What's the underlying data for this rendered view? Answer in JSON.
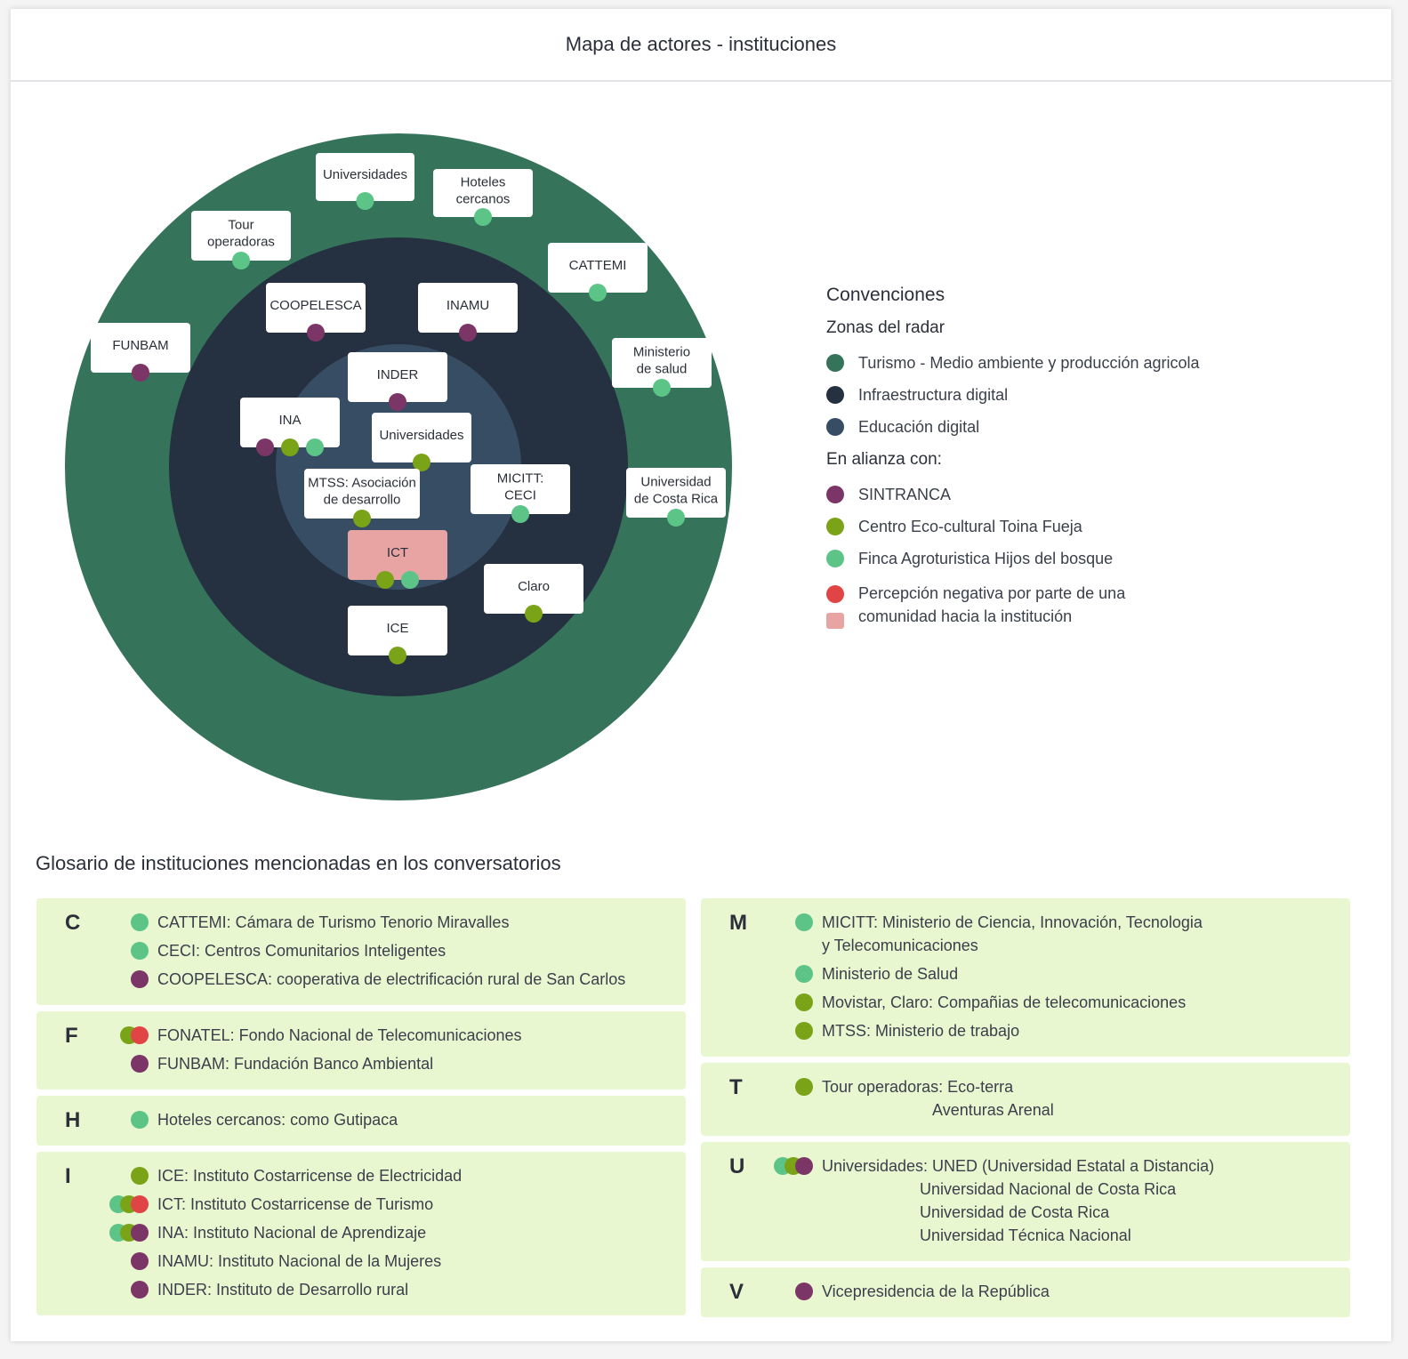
{
  "title": "Mapa de actores - instituciones",
  "colors": {
    "zone_outer": "#35735a",
    "zone_middle": "#253040",
    "zone_inner": "#374d63",
    "sintranca": "#7c3567",
    "toina": "#7aa317",
    "finca": "#5cc487",
    "negative": "#e04444",
    "negative_fill": "#e8a3a3"
  },
  "radar": {
    "nodes": [
      {
        "lines": [
          "Universidades"
        ],
        "dots": [
          "finca"
        ]
      },
      {
        "lines": [
          "Hoteles",
          "cercanos"
        ],
        "dots": [
          "finca"
        ]
      },
      {
        "lines": [
          "Tour",
          "operadoras"
        ],
        "dots": [
          "finca"
        ]
      },
      {
        "lines": [
          "CATTEMI"
        ],
        "dots": [
          "finca"
        ]
      },
      {
        "lines": [
          "FUNBAM"
        ],
        "dots": [
          "sintranca"
        ]
      },
      {
        "lines": [
          "Ministerio",
          "de salud"
        ],
        "dots": [
          "finca"
        ]
      },
      {
        "lines": [
          "Universidad",
          "de Costa Rica"
        ],
        "dots": [
          "finca"
        ]
      },
      {
        "lines": [
          "COOPELESCA"
        ],
        "dots": [
          "sintranca"
        ]
      },
      {
        "lines": [
          "INAMU"
        ],
        "dots": [
          "sintranca"
        ]
      },
      {
        "lines": [
          "INDER"
        ],
        "dots": [
          "sintranca"
        ]
      },
      {
        "lines": [
          "INA"
        ],
        "dots": [
          "sintranca",
          "toina",
          "finca"
        ]
      },
      {
        "lines": [
          "Universidades"
        ],
        "dots": [
          "toina"
        ]
      },
      {
        "lines": [
          "MTSS: Asociación",
          "de desarrollo"
        ],
        "dots": [
          "toina"
        ]
      },
      {
        "lines": [
          "MICITT:",
          "CECI"
        ],
        "dots": [
          "finca"
        ]
      },
      {
        "lines": [
          "ICT"
        ],
        "dots": [
          "toina",
          "finca"
        ],
        "negative": true
      },
      {
        "lines": [
          "Claro"
        ],
        "dots": [
          "toina"
        ]
      },
      {
        "lines": [
          "ICE"
        ],
        "dots": [
          "toina"
        ]
      }
    ]
  },
  "legend": {
    "heading": "Convenciones",
    "zones_title": "Zonas del radar",
    "zones": [
      {
        "label": "Turismo - Medio ambiente y producción agricola",
        "color": "zone_outer"
      },
      {
        "label": "Infraestructura digital",
        "color": "zone_middle"
      },
      {
        "label": "Educación digital",
        "color": "zone_inner"
      }
    ],
    "alliance_title": "En alianza con:",
    "alliances": [
      {
        "label": "SINTRANCA",
        "color": "sintranca"
      },
      {
        "label": "Centro Eco-cultural Toina Fueja",
        "color": "toina"
      },
      {
        "label": "Finca Agroturistica Hijos del bosque",
        "color": "finca"
      }
    ],
    "negative_label": "Percepción negativa por parte de una\ncomunidad hacia la institución"
  },
  "glossary": {
    "title": "Glosario de instituciones mencionadas en los conversatorios",
    "left": [
      {
        "letter": "C",
        "items": [
          {
            "text": "CATTEMI: Cámara de Turismo Tenorio Miravalles",
            "dots": [
              "finca"
            ]
          },
          {
            "text": "CECI: Centros Comunitarios Inteligentes",
            "dots": [
              "finca"
            ]
          },
          {
            "text": "COOPELESCA: cooperativa de electrificación rural de San Carlos",
            "dots": [
              "sintranca"
            ]
          }
        ]
      },
      {
        "letter": "F",
        "items": [
          {
            "text": "FONATEL: Fondo Nacional de Telecomunicaciones",
            "dots": [
              "toina",
              "negative"
            ]
          },
          {
            "text": "FUNBAM: Fundación Banco Ambiental",
            "dots": [
              "sintranca"
            ]
          }
        ]
      },
      {
        "letter": "H",
        "items": [
          {
            "text": "Hoteles cercanos: como Gutipaca",
            "dots": [
              "finca"
            ]
          }
        ]
      },
      {
        "letter": "I",
        "items": [
          {
            "text": "ICE: Instituto Costarricense de Electricidad",
            "dots": [
              "toina"
            ]
          },
          {
            "text": "ICT: Instituto Costarricense de Turismo",
            "dots": [
              "finca",
              "toina",
              "negative"
            ]
          },
          {
            "text": "INA: Instituto Nacional de Aprendizaje",
            "dots": [
              "finca",
              "toina",
              "sintranca"
            ]
          },
          {
            "text": "INAMU: Instituto Nacional de la Mujeres",
            "dots": [
              "sintranca"
            ]
          },
          {
            "text": "INDER: Instituto de Desarrollo rural",
            "dots": [
              "sintranca"
            ]
          }
        ]
      }
    ],
    "right": [
      {
        "letter": "M",
        "items": [
          {
            "text": "MICITT: Ministerio de Ciencia, Innovación, Tecnologia\ny Telecomunicaciones",
            "dots": [
              "finca"
            ]
          },
          {
            "text": "Ministerio de Salud",
            "dots": [
              "finca"
            ]
          },
          {
            "text": "Movistar, Claro: Compañias de telecomunicaciones",
            "dots": [
              "toina"
            ]
          },
          {
            "text": "MTSS: Ministerio de trabajo",
            "dots": [
              "toina"
            ]
          }
        ]
      },
      {
        "letter": "T",
        "items": [
          {
            "text": "Tour operadoras: Eco-terra\n                         Aventuras Arenal",
            "dots": [
              "toina"
            ]
          }
        ]
      },
      {
        "letter": "U",
        "items": [
          {
            "text": "Universidades: UNED (Universidad Estatal a Distancia)\n                      Universidad Nacional de Costa Rica\n                      Universidad de Costa Rica\n                      Universidad Técnica Nacional",
            "dots": [
              "finca",
              "toina",
              "sintranca"
            ]
          }
        ]
      },
      {
        "letter": "V",
        "items": [
          {
            "text": "Vicepresidencia de la República",
            "dots": [
              "sintranca"
            ]
          }
        ]
      }
    ]
  }
}
